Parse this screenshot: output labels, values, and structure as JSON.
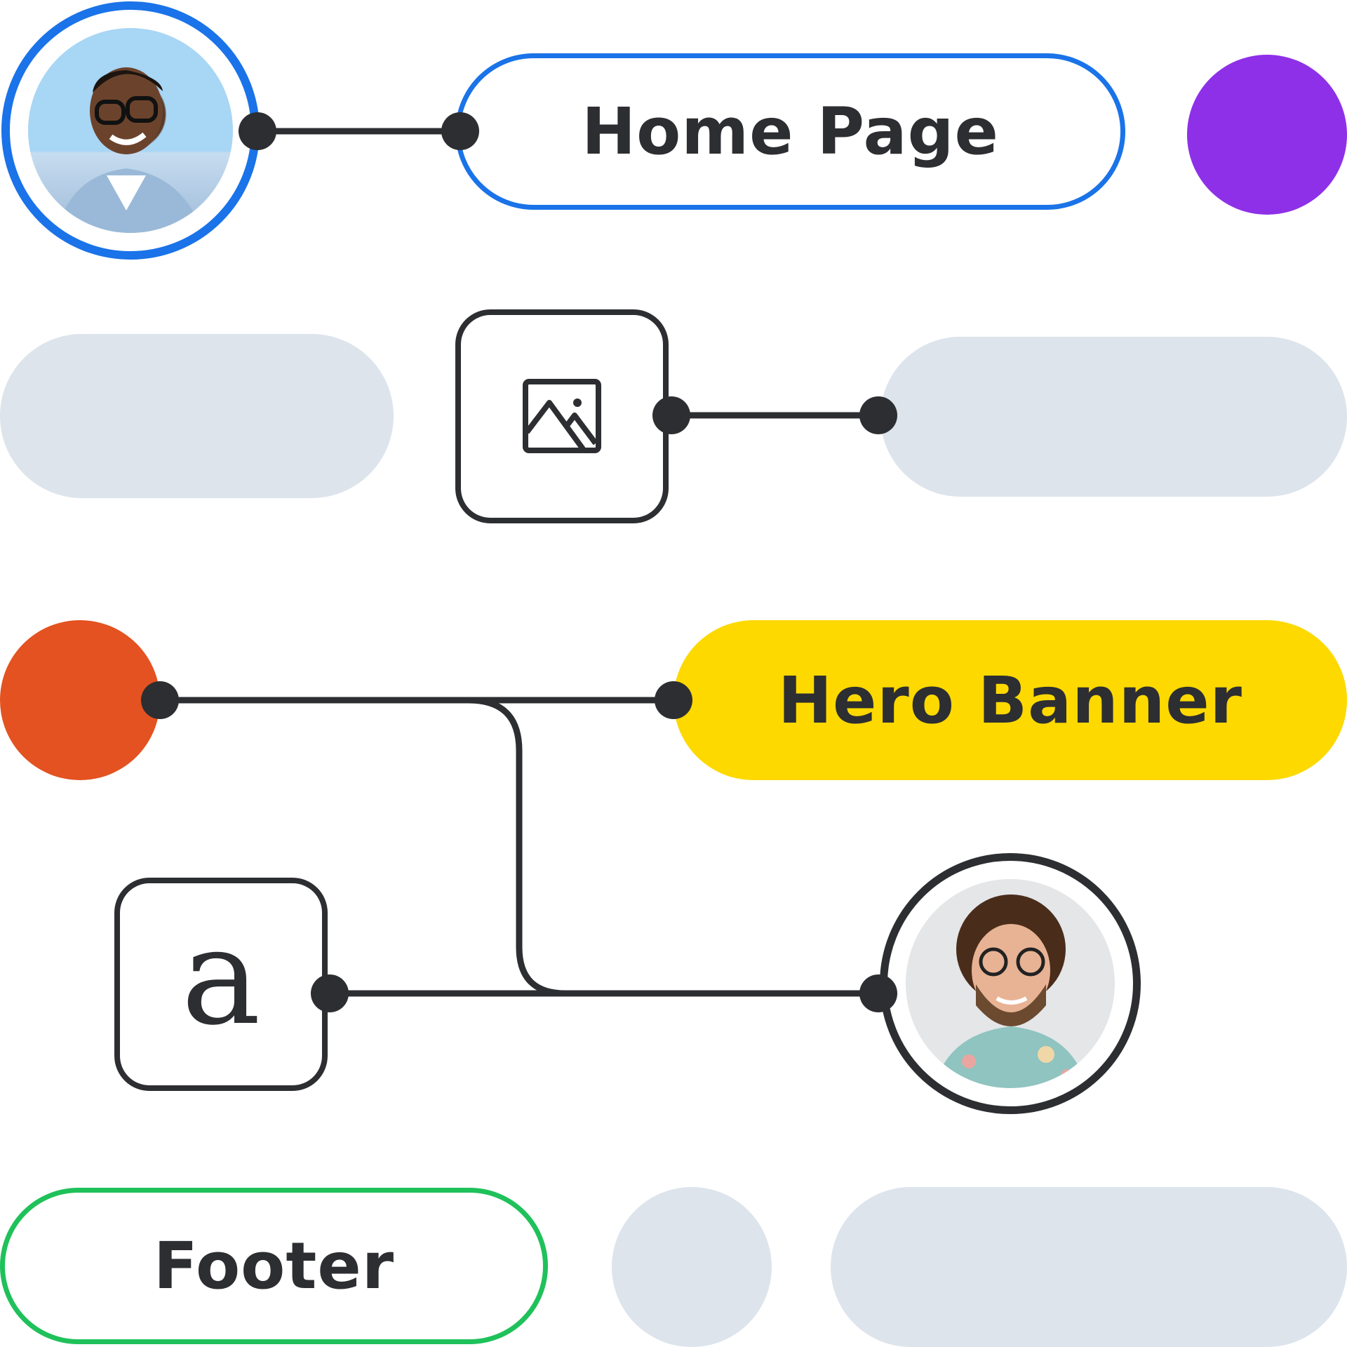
{
  "nodes": {
    "home_page": {
      "label": "Home Page",
      "border_color": "#1a73e8"
    },
    "hero_banner": {
      "label": "Hero Banner",
      "fill_color": "#fdd900"
    },
    "footer": {
      "label": "Footer",
      "border_color": "#1fc15a"
    },
    "text_block": {
      "glyph": "a",
      "icon": "text-glyph-icon"
    },
    "image_block": {
      "icon": "image-icon"
    },
    "avatar_1": {
      "ring_color": "#1a73e8",
      "description": "smiling person with glasses"
    },
    "avatar_2": {
      "ring_color": "#2d2e31",
      "description": "curly-haired person with glasses"
    },
    "purple_dot": {
      "color": "#8e30e8"
    },
    "orange_dot": {
      "color": "#e35220"
    },
    "placeholder_color": "#dde4ec"
  },
  "colors": {
    "wire": "#2d2e31",
    "text": "#2d2e31"
  }
}
